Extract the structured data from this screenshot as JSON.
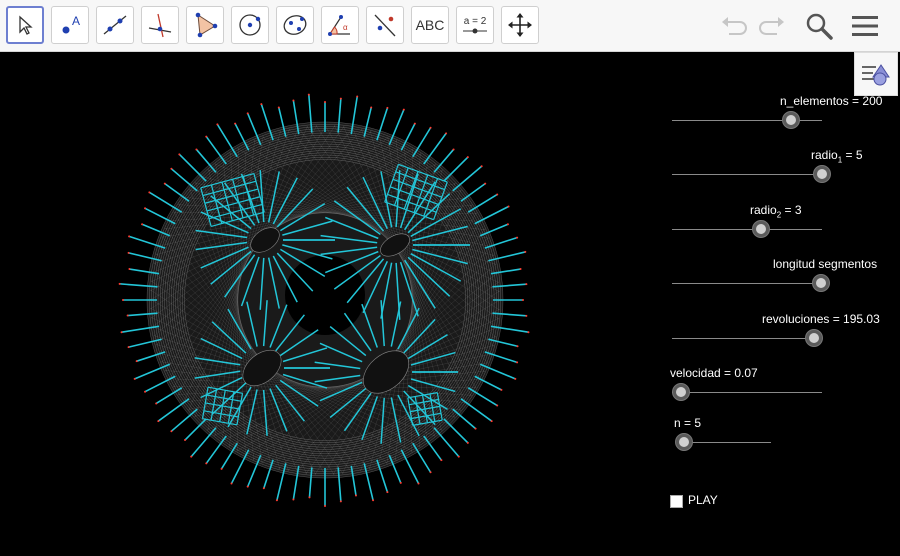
{
  "toolbar": {
    "text_tool_label": "ABC",
    "slider_tool_label": "a = 2"
  },
  "sliders": [
    {
      "key": "n_elementos",
      "label": "n_elementos = 200",
      "value": 200,
      "fraction": 0.79
    },
    {
      "key": "radio1",
      "label_main": "radio",
      "label_sub": "1",
      "label_rest": " = 5",
      "value": 5,
      "fraction": 1.0
    },
    {
      "key": "radio2",
      "label_main": "radio",
      "label_sub": "2",
      "label_rest": " = 3",
      "value": 3,
      "fraction": 0.6
    },
    {
      "key": "longitud",
      "label": "longitud segmentos",
      "fraction": 0.99
    },
    {
      "key": "revoluciones",
      "label": "revoluciones = 195.03",
      "value": 195.03,
      "fraction": 0.96
    },
    {
      "key": "velocidad",
      "label": "velocidad = 0.07",
      "value": 0.07,
      "fraction": 0.0
    },
    {
      "key": "n",
      "label": "n = 5",
      "value": 5,
      "fraction": 0.0
    }
  ],
  "play": {
    "label": "PLAY",
    "checked": false
  },
  "colors": {
    "segment": "#23c6d8",
    "curve": "#cfcfcf",
    "background": "#000000",
    "dot": "#ff3b30"
  }
}
